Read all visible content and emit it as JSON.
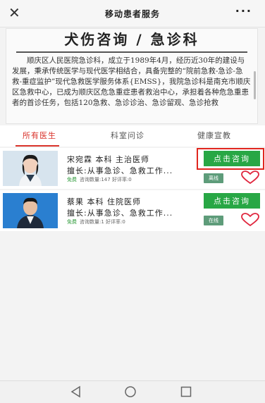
{
  "header": {
    "close_icon": "close-icon",
    "title": "移动患者服务",
    "more_label": "···"
  },
  "intro": {
    "title": "犬伤咨询 / 急诊科",
    "text": "顺庆区人民医院急诊科，成立于1989年4月，经历近30年的建设与发展，秉承传统医学与现代医学相结合，具备完整的“院前急救-急诊-急救-重症监护”现代急救医学服务体系{EMSS}，我院急诊科是南充市顺庆区急救中心，已成为顺庆区危急重症患者救治中心，承担着各种危急重患者的首诊任务，包括120急救、急诊诊治、急诊留观、急诊抢救"
  },
  "tabs": [
    "所有医生",
    "科室问诊",
    "健康宣教"
  ],
  "doctors": [
    {
      "name": "宋宛霖 本科 主治医师",
      "specialty": "擅长:从事急诊、急救工作...",
      "free": "免费",
      "stats": "咨询数量:147 好评率:0",
      "consult_label": "点击咨询",
      "status": "离线"
    },
    {
      "name": "蔡果 本科 住院医师",
      "specialty": "擅长:从事急诊、急救工作...",
      "free": "免费",
      "stats": "咨询数量:1 好评率:0",
      "consult_label": "点击咨询",
      "status": "在线"
    }
  ],
  "colors": {
    "accent": "#d9332b",
    "consult_green": "#28a745",
    "status_green": "#5e9c7a",
    "highlight_red": "#e0261e"
  }
}
